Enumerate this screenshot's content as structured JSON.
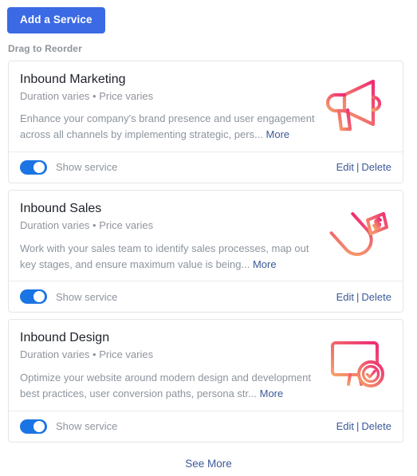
{
  "toolbar": {
    "add_service_label": "Add a Service"
  },
  "reorder_hint": "Drag to Reorder",
  "colors": {
    "primary_button": "#3b6ae4",
    "toggle_on": "#1b74e4",
    "link": "#3b5998",
    "muted_text": "#8d949e",
    "title_text": "#1d2129",
    "card_border": "#e3e5e8",
    "icon_gradient_start": "#f5a269",
    "icon_gradient_end": "#ed2c74"
  },
  "services": [
    {
      "title": "Inbound Marketing",
      "meta": "Duration varies • Price varies",
      "description": "Enhance your company's brand presence and user engagement across all channels by implementing strategic, pers...",
      "more_label": "More",
      "icon": "megaphone-icon",
      "toggle_label": "Show service",
      "toggle_on": true,
      "edit_label": "Edit",
      "separator": "|",
      "delete_label": "Delete"
    },
    {
      "title": "Inbound Sales",
      "meta": "Duration varies • Price varies",
      "description": "Work with your sales team to identify sales processes, map out key stages, and ensure maximum value is being...",
      "more_label": "More",
      "icon": "magnet-money-icon",
      "toggle_label": "Show service",
      "toggle_on": true,
      "edit_label": "Edit",
      "separator": "|",
      "delete_label": "Delete"
    },
    {
      "title": "Inbound Design",
      "meta": "Duration varies • Price varies",
      "description": "Optimize your website around modern design and development best practices, user conversion paths, persona str...",
      "more_label": "More",
      "icon": "monitor-check-icon",
      "toggle_label": "Show service",
      "toggle_on": true,
      "edit_label": "Edit",
      "separator": "|",
      "delete_label": "Delete"
    }
  ],
  "footer": {
    "see_more_label": "See More"
  }
}
